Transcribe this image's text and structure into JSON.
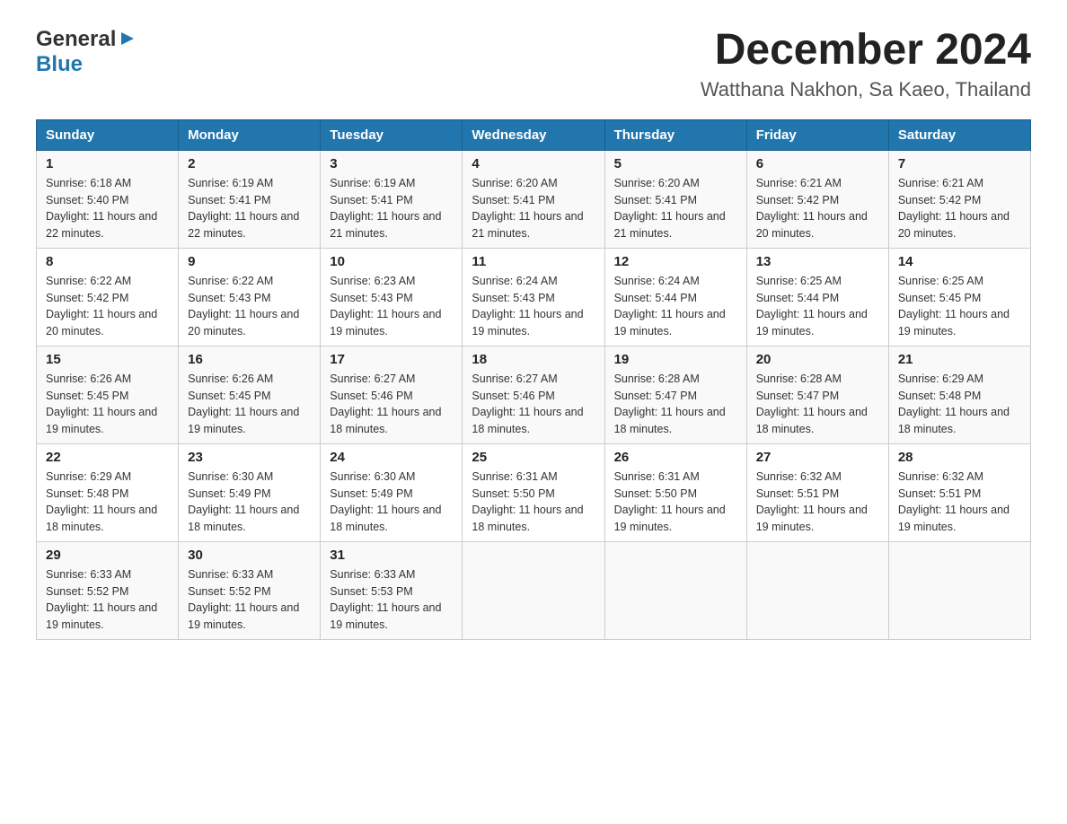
{
  "header": {
    "logo": {
      "general": "General",
      "blue": "Blue",
      "arrow": "▶"
    },
    "title": "December 2024",
    "subtitle": "Watthana Nakhon, Sa Kaeo, Thailand"
  },
  "calendar": {
    "days_of_week": [
      "Sunday",
      "Monday",
      "Tuesday",
      "Wednesday",
      "Thursday",
      "Friday",
      "Saturday"
    ],
    "weeks": [
      [
        {
          "day": "1",
          "sunrise": "6:18 AM",
          "sunset": "5:40 PM",
          "daylight": "11 hours and 22 minutes."
        },
        {
          "day": "2",
          "sunrise": "6:19 AM",
          "sunset": "5:41 PM",
          "daylight": "11 hours and 22 minutes."
        },
        {
          "day": "3",
          "sunrise": "6:19 AM",
          "sunset": "5:41 PM",
          "daylight": "11 hours and 21 minutes."
        },
        {
          "day": "4",
          "sunrise": "6:20 AM",
          "sunset": "5:41 PM",
          "daylight": "11 hours and 21 minutes."
        },
        {
          "day": "5",
          "sunrise": "6:20 AM",
          "sunset": "5:41 PM",
          "daylight": "11 hours and 21 minutes."
        },
        {
          "day": "6",
          "sunrise": "6:21 AM",
          "sunset": "5:42 PM",
          "daylight": "11 hours and 20 minutes."
        },
        {
          "day": "7",
          "sunrise": "6:21 AM",
          "sunset": "5:42 PM",
          "daylight": "11 hours and 20 minutes."
        }
      ],
      [
        {
          "day": "8",
          "sunrise": "6:22 AM",
          "sunset": "5:42 PM",
          "daylight": "11 hours and 20 minutes."
        },
        {
          "day": "9",
          "sunrise": "6:22 AM",
          "sunset": "5:43 PM",
          "daylight": "11 hours and 20 minutes."
        },
        {
          "day": "10",
          "sunrise": "6:23 AM",
          "sunset": "5:43 PM",
          "daylight": "11 hours and 19 minutes."
        },
        {
          "day": "11",
          "sunrise": "6:24 AM",
          "sunset": "5:43 PM",
          "daylight": "11 hours and 19 minutes."
        },
        {
          "day": "12",
          "sunrise": "6:24 AM",
          "sunset": "5:44 PM",
          "daylight": "11 hours and 19 minutes."
        },
        {
          "day": "13",
          "sunrise": "6:25 AM",
          "sunset": "5:44 PM",
          "daylight": "11 hours and 19 minutes."
        },
        {
          "day": "14",
          "sunrise": "6:25 AM",
          "sunset": "5:45 PM",
          "daylight": "11 hours and 19 minutes."
        }
      ],
      [
        {
          "day": "15",
          "sunrise": "6:26 AM",
          "sunset": "5:45 PM",
          "daylight": "11 hours and 19 minutes."
        },
        {
          "day": "16",
          "sunrise": "6:26 AM",
          "sunset": "5:45 PM",
          "daylight": "11 hours and 19 minutes."
        },
        {
          "day": "17",
          "sunrise": "6:27 AM",
          "sunset": "5:46 PM",
          "daylight": "11 hours and 18 minutes."
        },
        {
          "day": "18",
          "sunrise": "6:27 AM",
          "sunset": "5:46 PM",
          "daylight": "11 hours and 18 minutes."
        },
        {
          "day": "19",
          "sunrise": "6:28 AM",
          "sunset": "5:47 PM",
          "daylight": "11 hours and 18 minutes."
        },
        {
          "day": "20",
          "sunrise": "6:28 AM",
          "sunset": "5:47 PM",
          "daylight": "11 hours and 18 minutes."
        },
        {
          "day": "21",
          "sunrise": "6:29 AM",
          "sunset": "5:48 PM",
          "daylight": "11 hours and 18 minutes."
        }
      ],
      [
        {
          "day": "22",
          "sunrise": "6:29 AM",
          "sunset": "5:48 PM",
          "daylight": "11 hours and 18 minutes."
        },
        {
          "day": "23",
          "sunrise": "6:30 AM",
          "sunset": "5:49 PM",
          "daylight": "11 hours and 18 minutes."
        },
        {
          "day": "24",
          "sunrise": "6:30 AM",
          "sunset": "5:49 PM",
          "daylight": "11 hours and 18 minutes."
        },
        {
          "day": "25",
          "sunrise": "6:31 AM",
          "sunset": "5:50 PM",
          "daylight": "11 hours and 18 minutes."
        },
        {
          "day": "26",
          "sunrise": "6:31 AM",
          "sunset": "5:50 PM",
          "daylight": "11 hours and 19 minutes."
        },
        {
          "day": "27",
          "sunrise": "6:32 AM",
          "sunset": "5:51 PM",
          "daylight": "11 hours and 19 minutes."
        },
        {
          "day": "28",
          "sunrise": "6:32 AM",
          "sunset": "5:51 PM",
          "daylight": "11 hours and 19 minutes."
        }
      ],
      [
        {
          "day": "29",
          "sunrise": "6:33 AM",
          "sunset": "5:52 PM",
          "daylight": "11 hours and 19 minutes."
        },
        {
          "day": "30",
          "sunrise": "6:33 AM",
          "sunset": "5:52 PM",
          "daylight": "11 hours and 19 minutes."
        },
        {
          "day": "31",
          "sunrise": "6:33 AM",
          "sunset": "5:53 PM",
          "daylight": "11 hours and 19 minutes."
        },
        null,
        null,
        null,
        null
      ]
    ]
  }
}
